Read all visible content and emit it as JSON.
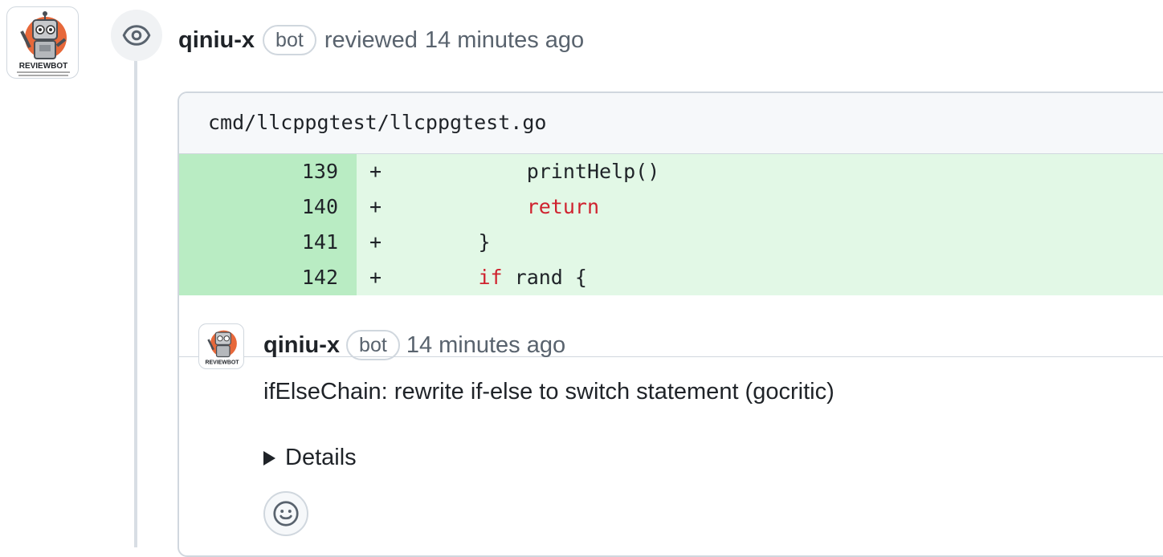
{
  "review": {
    "author": "qiniu-x",
    "badge": "bot",
    "action": "reviewed",
    "time": "14 minutes ago",
    "avatar_text": "REVIEWBOT"
  },
  "file": {
    "path": "cmd/llcppgtest/llcppgtest.go",
    "lines": [
      {
        "num": "139",
        "sign": "+",
        "indent": "            ",
        "keyword": "",
        "text": "printHelp()"
      },
      {
        "num": "140",
        "sign": "+",
        "indent": "            ",
        "keyword": "return",
        "text": ""
      },
      {
        "num": "141",
        "sign": "+",
        "indent": "        ",
        "keyword": "",
        "text": "}"
      },
      {
        "num": "142",
        "sign": "+",
        "indent": "        ",
        "keyword": "if",
        "text": " rand {"
      }
    ]
  },
  "comment": {
    "author": "qiniu-x",
    "badge": "bot",
    "time": "14 minutes ago",
    "body": "ifElseChain: rewrite if-else to switch statement (gocritic)",
    "details_label": "Details"
  },
  "icons": {
    "timeline": "eye-icon",
    "reaction": "smiley-icon",
    "details_toggle": "triangle-right-icon"
  },
  "colors": {
    "addition_line_bg": "#e2f8e6",
    "addition_num_bg": "#b9ecc3",
    "keyword": "#cf222e",
    "muted": "#59636e"
  }
}
